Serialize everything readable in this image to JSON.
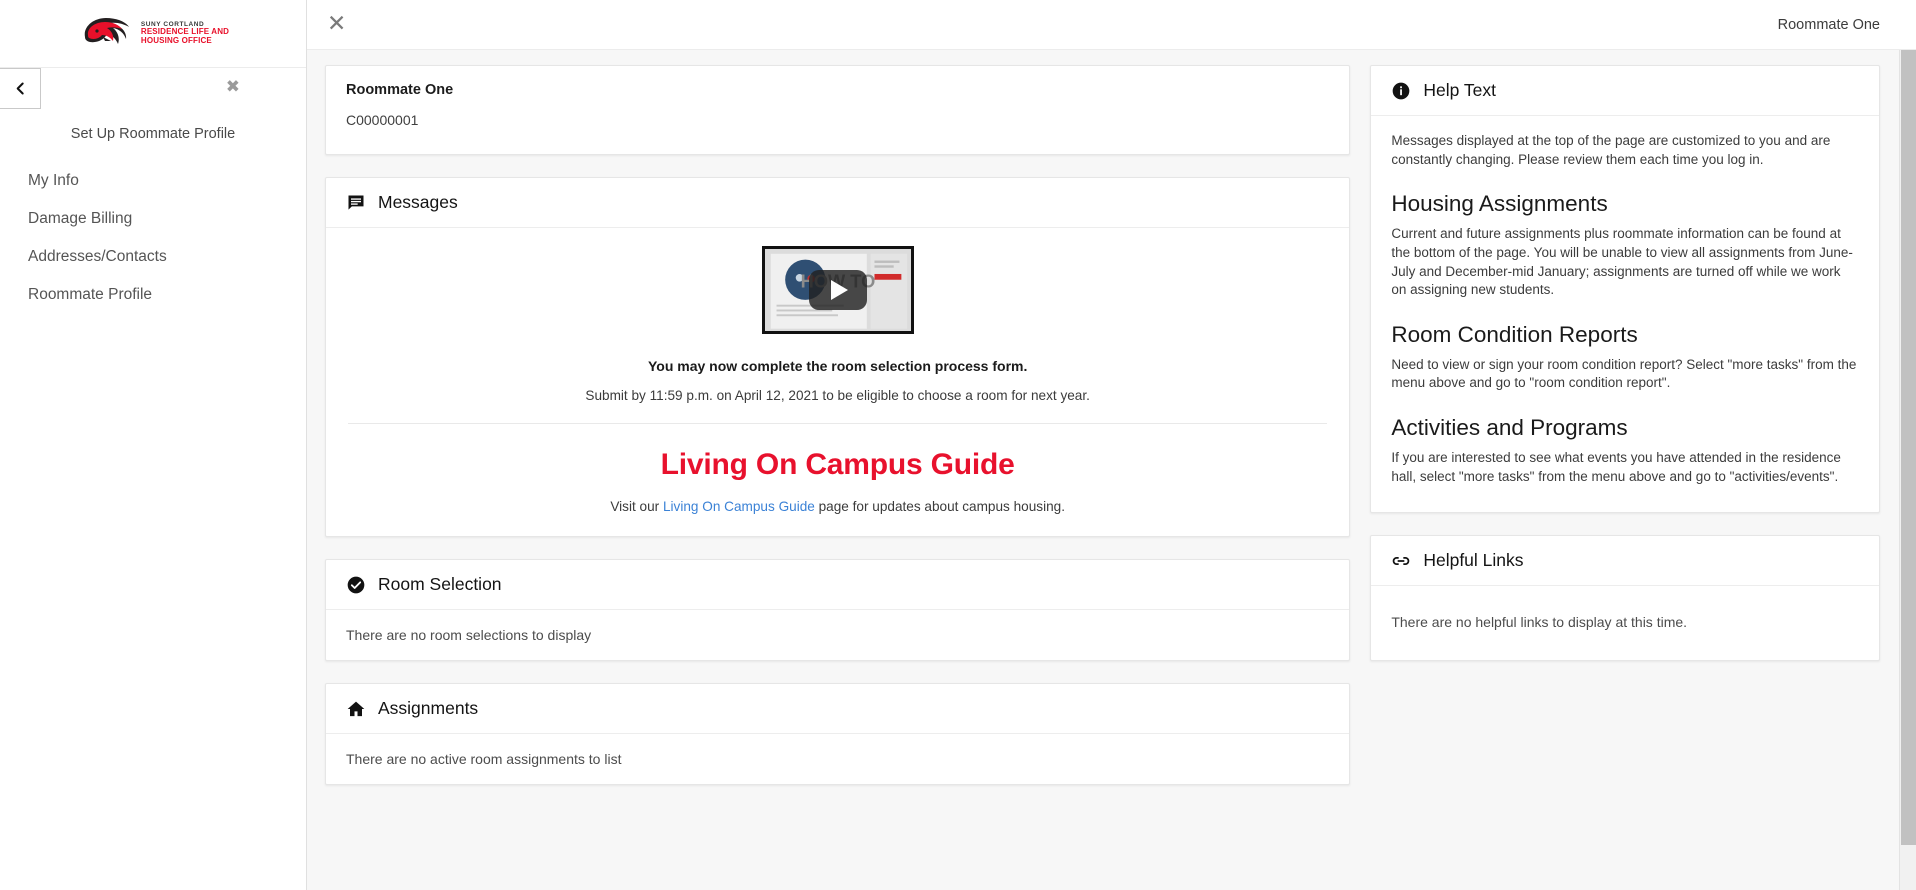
{
  "sidebar": {
    "logo": {
      "icon": "dragon-logo-icon",
      "line1": "SUNY CORTLAND",
      "line2": "RESIDENCE LIFE AND",
      "line3": "HOUSING OFFICE",
      "brand_color": "#e8102a"
    },
    "back_icon": "chevron-left-icon",
    "close_icon": "close-icon",
    "title": "Set Up Roommate Profile",
    "items": [
      {
        "label": "My Info"
      },
      {
        "label": "Damage Billing"
      },
      {
        "label": "Addresses/Contacts"
      },
      {
        "label": "Roommate Profile"
      }
    ]
  },
  "topbar": {
    "close_icon": "close-icon",
    "user": "Roommate One"
  },
  "profile": {
    "name": "Roommate One",
    "id": "C00000001"
  },
  "messages": {
    "icon": "message-icon",
    "title": "Messages",
    "video": {
      "icon": "play-button-icon",
      "label": "HOW TO"
    },
    "headline": "You may now complete the room selection process form.",
    "subline": "Submit by 11:59 p.m. on April 12, 2021 to be eligible to choose a room for next year.",
    "guide_title": "Living On Campus Guide",
    "guide_title_color": "#e8112d",
    "guide_text_before": "Visit our ",
    "guide_link": "Living On Campus Guide",
    "guide_link_color": "#3b82d6",
    "guide_text_after": " page for updates about campus housing."
  },
  "room_selection": {
    "icon": "check-circle-icon",
    "title": "Room Selection",
    "empty": "There are no room selections to display"
  },
  "assignments": {
    "icon": "home-icon",
    "title": "Assignments",
    "empty": "There are no active room assignments to list"
  },
  "help_text": {
    "icon": "info-icon",
    "title": "Help Text",
    "lead": "Messages displayed at the top of the page are customized to you and are constantly changing. Please review them each time you log in.",
    "sections": [
      {
        "heading": "Housing Assignments",
        "body": "Current and future assignments plus roommate information can be found at the bottom of the page. You will be unable to view all assignments from June-July and December-mid January; assignments are turned off while we work on assigning new students."
      },
      {
        "heading": "Room Condition Reports",
        "body": "Need to view or sign your room condition report? Select \"more tasks\" from the menu above and go to \"room condition report\"."
      },
      {
        "heading": "Activities and Programs",
        "body": "If you are interested to see what events you have attended in the residence hall, select \"more tasks\" from the menu above and go to \"activities/events\"."
      }
    ]
  },
  "helpful_links": {
    "icon": "link-icon",
    "title": "Helpful Links",
    "empty": "There are no helpful links to display at this time."
  }
}
